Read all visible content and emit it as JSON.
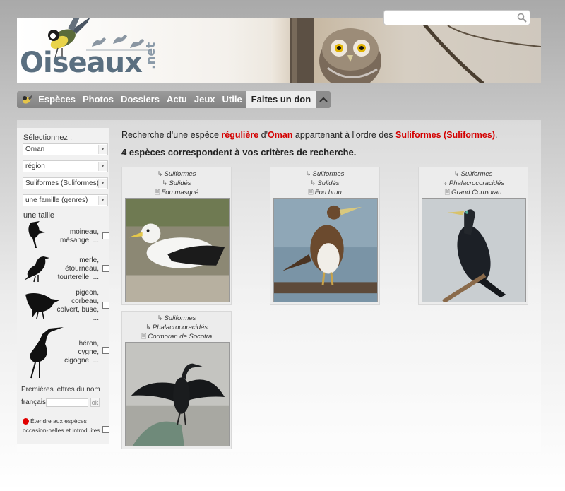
{
  "header": {
    "logo_text": "Oiseaux",
    "logo_suffix": ".net",
    "search": {
      "placeholder": "",
      "value": ""
    }
  },
  "nav": {
    "items": [
      "Espèces",
      "Photos",
      "Dossiers",
      "Actu",
      "Jeux",
      "Utile",
      "Faites un don"
    ],
    "active_index": 6
  },
  "sidebar": {
    "select_label": "Sélectionnez :",
    "country_value": "Oman",
    "region_value": "région",
    "order_value": "Suliformes (Suliformes)",
    "family_value": "une famille (genres)",
    "size_label": "une taille",
    "sizes": [
      {
        "text": "moineau,\nmésange, ...",
        "icon": "sparrow-silhouette"
      },
      {
        "text": "merle,\nétourneau,\ntourterelle, ...",
        "icon": "blackbird-silhouette"
      },
      {
        "text": "pigeon,\ncorbeau,\ncolvert, buse,\n...",
        "icon": "crow-silhouette"
      },
      {
        "text": "héron,\ncygne,\ncigogne, ...",
        "icon": "heron-silhouette"
      }
    ],
    "first_letters_label": "Premières lettres du nom",
    "french_label": "français",
    "ok_label": "ok",
    "extend_label": "Étendre aux espèces occasion-nelles et introduites"
  },
  "results": {
    "line_prefix": "Recherche d'une espèce ",
    "status": "régulière",
    "line_mid": " d'",
    "country": "Oman",
    "line_mid2": " appartenant à l'ordre des ",
    "order": "Suliformes (Suliformes)",
    "line_suffix": ".",
    "count_text": "4 espèces correspondent à vos critères de recherche.",
    "cards": [
      {
        "order": "Suliformes",
        "family": "Sulidés",
        "species": "Fou masqué"
      },
      {
        "order": "Suliformes",
        "family": "Sulidés",
        "species": "Fou brun"
      },
      {
        "order": "Suliformes",
        "family": "Phalacrocoracidés",
        "species": "Grand Cormoran"
      },
      {
        "order": "Suliformes",
        "family": "Phalacrocoracidés",
        "species": "Cormoran de Socotra"
      }
    ]
  },
  "colors": {
    "highlight": "#d40000",
    "nav_bg": "#8f8f8f",
    "logo": "#5a6f80",
    "extend_dot": "#e10000"
  }
}
